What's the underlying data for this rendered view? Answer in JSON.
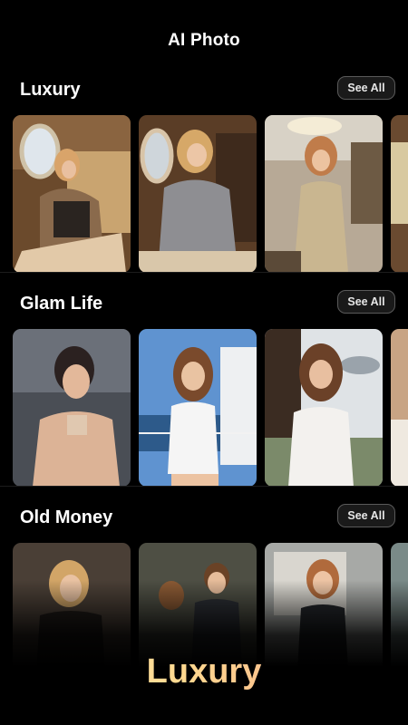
{
  "header": {
    "title": "AI Photo"
  },
  "sections": [
    {
      "title": "Luxury",
      "see_all": "See All"
    },
    {
      "title": "Glam Life",
      "see_all": "See All"
    },
    {
      "title": "Old Money",
      "see_all": "See All"
    }
  ],
  "caption": {
    "text": "Luxury"
  },
  "colors": {
    "background": "#000000",
    "button_border": "#5a5a5a",
    "caption_gradient": [
      "#fff2b8",
      "#ffd88f",
      "#f4a38d"
    ]
  }
}
